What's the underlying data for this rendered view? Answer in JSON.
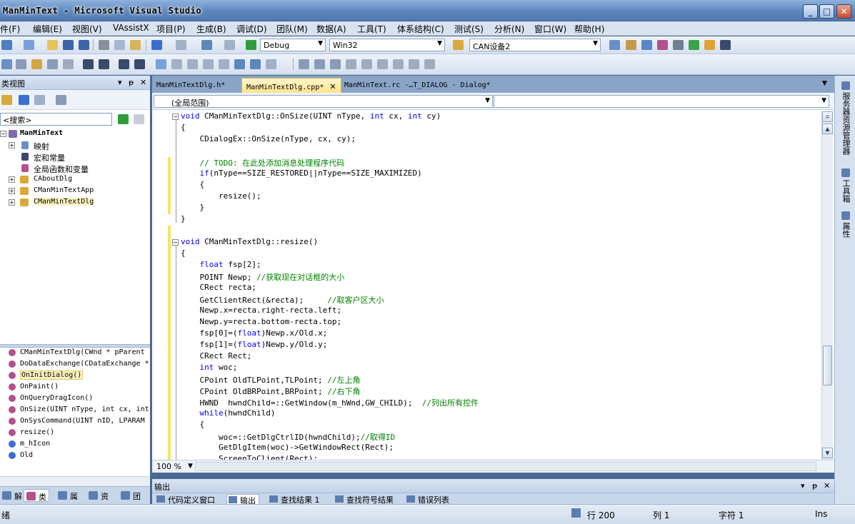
{
  "window": {
    "title": "ManMinText - Microsoft Visual Studio",
    "buttons": {
      "minimize": "_",
      "maximize": "□",
      "close": "✕"
    }
  },
  "menu": [
    "件(F)",
    "编辑(E)",
    "视图(V)",
    "VAssistX",
    "项目(P)",
    "生成(B)",
    "调试(D)",
    "团队(M)",
    "数据(A)",
    "工具(T)",
    "体系结构(C)",
    "测试(S)",
    "分析(N)",
    "窗口(W)",
    "帮助(H)"
  ],
  "toolbar": {
    "config": "Debug",
    "platform": "Win32",
    "find_combo": "CAN设备2"
  },
  "left_pane": {
    "title": "类视图",
    "title_visible": "类视图",
    "search_placeholder": "<搜索>",
    "tree": [
      {
        "label": "ManMinText",
        "bold": true
      },
      {
        "label": "映射"
      },
      {
        "label": "宏和常量"
      },
      {
        "label": "全局函数和变量"
      },
      {
        "label": "CAboutDlg"
      },
      {
        "label": "CManMinTextApp"
      },
      {
        "label": "CManMinTextDlg"
      }
    ],
    "members": [
      "CManMinTextDlg(CWnd * pParent",
      "DoDataExchange(CDataExchange *",
      "OnInitDialog()",
      "OnPaint()",
      "OnQueryDragIcon()",
      "OnSize(UINT nType, int cx, int",
      "OnSysCommand(UINT nID, LPARAM",
      "resize()",
      "m_hIcon",
      "Old"
    ],
    "bottom_tabs": [
      "解",
      "类",
      "属",
      "资",
      "团"
    ]
  },
  "doc_tabs": [
    {
      "label": "ManMinTextDlg.h*"
    },
    {
      "label": "ManMinTextDlg.cpp*",
      "close": "✕"
    },
    {
      "label": "ManMinText.rc -…T_DIALOG - Dialog*"
    }
  ],
  "nav": {
    "scope": "(全局范围)"
  },
  "code": [
    "void CManMinTextDlg::OnSize(UINT nType, int cx, int cy)",
    "{",
    "    CDialogEx::OnSize(nType, cx, cy);",
    "",
    "    // TODO: 在此处添加消息处理程序代码",
    "    if(nType==SIZE_RESTORED||nType==SIZE_MAXIMIZED)",
    "    {",
    "        resize();",
    "    }",
    "}",
    "",
    "void CManMinTextDlg::resize()",
    "{",
    "    float fsp[2];",
    "    POINT Newp; //获取现在对话框的大小",
    "    CRect recta;",
    "    GetClientRect(&recta);     //取客户区大小",
    "    Newp.x=recta.right-recta.left;",
    "    Newp.y=recta.bottom-recta.top;",
    "    fsp[0]=(float)Newp.x/Old.x;",
    "    fsp[1]=(float)Newp.y/Old.y;",
    "    CRect Rect;",
    "    int woc;",
    "    CPoint OldTLPoint,TLPoint; //左上角",
    "    CPoint OldBRPoint,BRPoint; //右下角",
    "    HWND  hwndChild=::GetWindow(m_hWnd,GW_CHILD);  //列出所有控件",
    "    while(hwndChild)",
    "    {",
    "        woc=::GetDlgCtrlID(hwndChild);//取得ID",
    "        GetDlgItem(woc)->GetWindowRect(Rect);",
    "        ScreenToClient(Rect);"
  ],
  "editor_status": {
    "zoom": "100 %"
  },
  "output": {
    "title": "输出",
    "tabs": [
      "代码定义窗口",
      "输出",
      "查找结果 1",
      "查找符号结果",
      "错误列表"
    ]
  },
  "right_tabs": [
    "服务器资源管理器",
    "工具箱",
    "属性"
  ],
  "status": {
    "ready": "绪",
    "line": "行 200",
    "col": "列 1",
    "char": "字符 1",
    "mode": "Ins"
  },
  "colors": {
    "keyword": "#0000ff",
    "comment": "#008000",
    "active_tab": "#ffe38a"
  }
}
